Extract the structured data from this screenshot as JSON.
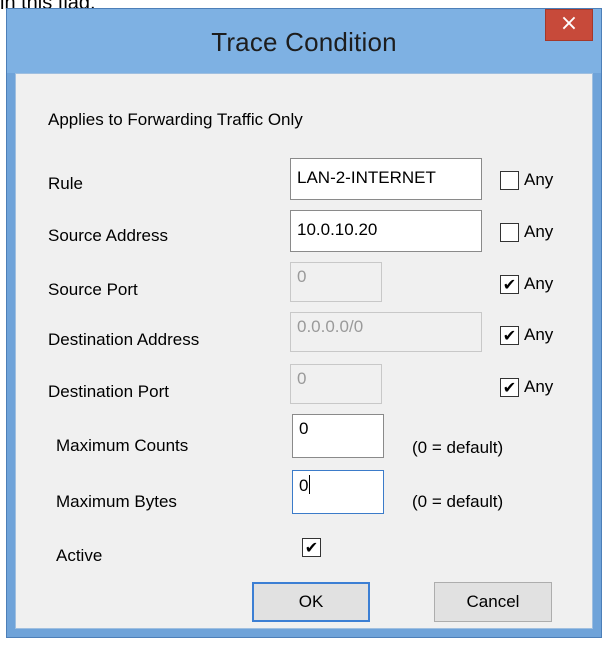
{
  "top_caption": "in this flag.",
  "window": {
    "title": "Trace Condition",
    "close_glyph": "×"
  },
  "header_text": "Applies to Forwarding Traffic Only",
  "rows": [
    {
      "label": "Rule",
      "value": "LAN-2-INTERNET",
      "any_label": "Any",
      "any_checked": false,
      "disabled": false
    },
    {
      "label": "Source Address",
      "value": "10.0.10.20",
      "any_label": "Any",
      "any_checked": false,
      "disabled": false
    },
    {
      "label": "Source Port",
      "value": "0",
      "any_label": "Any",
      "any_checked": true,
      "disabled": true
    },
    {
      "label": "Destination Address",
      "value": "0.0.0.0/0",
      "any_label": "Any",
      "any_checked": true,
      "disabled": true
    },
    {
      "label": "Destination Port",
      "value": "0",
      "any_label": "Any",
      "any_checked": true,
      "disabled": true
    }
  ],
  "max_counts": {
    "label": "Maximum Counts",
    "value": "0",
    "hint": "(0 = default)"
  },
  "max_bytes": {
    "label": "Maximum Bytes",
    "value": "0",
    "hint": "(0 = default)"
  },
  "active": {
    "label": "Active",
    "checked": true
  },
  "buttons": {
    "ok": "OK",
    "cancel": "Cancel"
  },
  "check_glyph": "✔"
}
